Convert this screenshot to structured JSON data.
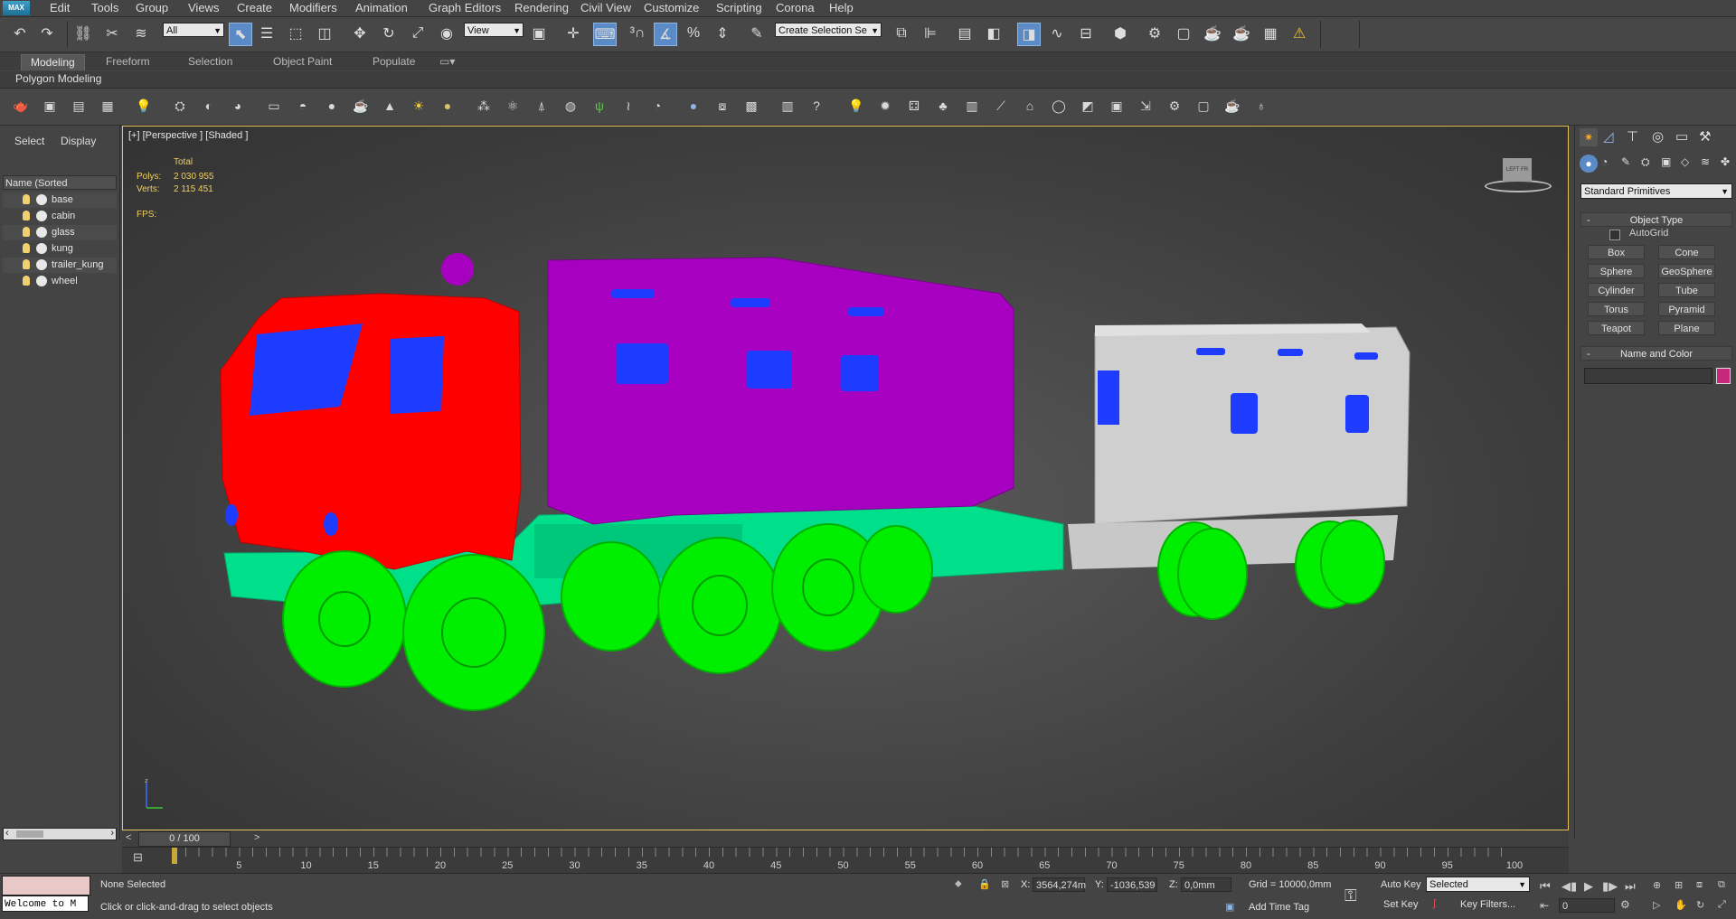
{
  "menu": {
    "logo": "MAX",
    "items": [
      "Edit",
      "Tools",
      "Group",
      "Views",
      "Create",
      "Modifiers",
      "Animation",
      "Graph Editors",
      "Rendering",
      "Civil View",
      "Customize",
      "Scripting",
      "Corona",
      "Help"
    ]
  },
  "main_toolbar": {
    "filter_value": "All",
    "refcoord_value": "View",
    "selection_set_placeholder": "Create Selection Se"
  },
  "ribbon": {
    "tabs": [
      "Modeling",
      "Freeform",
      "Selection",
      "Object Paint",
      "Populate"
    ],
    "active_tab": "Modeling",
    "panel_label": "Polygon Modeling"
  },
  "explorer": {
    "tabs": [
      "Select",
      "Display"
    ],
    "column_header": "Name (Sorted Ascending)",
    "objects": [
      "base",
      "cabin",
      "glass",
      "kung",
      "trailer_kung",
      "wheel"
    ]
  },
  "viewport": {
    "label": "[+] [Perspective ] [Shaded ]",
    "stats_header": "Total",
    "polys_label": "Polys:",
    "polys_value": "2 030 955",
    "verts_label": "Verts:",
    "verts_value": "2 115 451",
    "fps_label": "FPS:",
    "viewcube_label": "LEFT  FR",
    "model_colors": {
      "cabin": "#ff0000",
      "kung": "#a800c0",
      "base": "#00e08a",
      "wheel": "#00ee00",
      "glass": "#1e3cff",
      "trailer_kung": "#c8c8c8"
    }
  },
  "command_panel": {
    "category_value": "Standard Primitives",
    "object_type_title": "Object Type",
    "autogrid_label": "AutoGrid",
    "buttons": [
      "Box",
      "Cone",
      "Sphere",
      "GeoSphere",
      "Cylinder",
      "Tube",
      "Torus",
      "Pyramid",
      "Teapot",
      "Plane"
    ],
    "name_color_title": "Name and Color",
    "swatch_color": "#c8287a"
  },
  "time_slider": {
    "frame_label": "0 / 100",
    "prev": "<",
    "next": ">"
  },
  "timeline": {
    "ticks": [
      "5",
      "10",
      "15",
      "20",
      "25",
      "30",
      "35",
      "40",
      "45",
      "50",
      "55",
      "60",
      "65",
      "70",
      "75",
      "80",
      "85",
      "90",
      "95",
      "100"
    ]
  },
  "status": {
    "maxscript_text": "Welcome to M",
    "selection_text": "None Selected",
    "prompt_text": "Click or click-and-drag to select objects",
    "x_label": "X:",
    "x_value": "3564,274m",
    "y_label": "Y:",
    "y_value": "-1036,539",
    "z_label": "Z:",
    "z_value": "0,0mm",
    "grid_text": "Grid = 10000,0mm",
    "add_time_tag": "Add Time Tag",
    "auto_key": "Auto Key",
    "set_key": "Set Key",
    "key_mode_value": "Selected",
    "key_filters": "Key Filters...",
    "frame_value": "0"
  }
}
